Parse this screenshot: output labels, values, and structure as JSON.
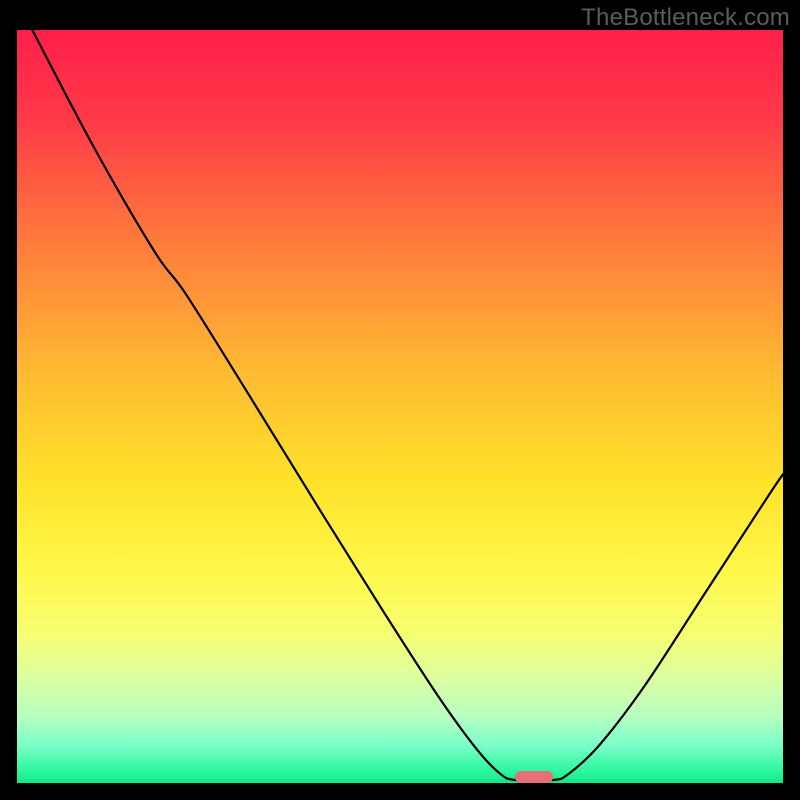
{
  "watermark": "TheBottleneck.com",
  "chart_data": {
    "type": "line",
    "title": "",
    "xlabel": "",
    "ylabel": "",
    "xlim": [
      0,
      100
    ],
    "ylim": [
      0,
      100
    ],
    "background_gradient_stops": [
      {
        "offset": 0.0,
        "color": "#ff1f4a"
      },
      {
        "offset": 0.12,
        "color": "#ff3a48"
      },
      {
        "offset": 0.28,
        "color": "#ff7a3c"
      },
      {
        "offset": 0.45,
        "color": "#ffb932"
      },
      {
        "offset": 0.6,
        "color": "#ffe22a"
      },
      {
        "offset": 0.72,
        "color": "#fff84a"
      },
      {
        "offset": 0.8,
        "color": "#f6ff70"
      },
      {
        "offset": 0.86,
        "color": "#dcffa0"
      },
      {
        "offset": 0.91,
        "color": "#b8ffc0"
      },
      {
        "offset": 0.95,
        "color": "#7affc8"
      },
      {
        "offset": 0.985,
        "color": "#29f79e"
      },
      {
        "offset": 1.0,
        "color": "#18e888"
      }
    ],
    "series": [
      {
        "name": "bottleneck-curve",
        "color": "#000000",
        "width": 2.2,
        "points": [
          {
            "x": 2.0,
            "y": 100.0
          },
          {
            "x": 10.0,
            "y": 84.5
          },
          {
            "x": 18.0,
            "y": 70.5
          },
          {
            "x": 22.0,
            "y": 65.0
          },
          {
            "x": 30.0,
            "y": 52.0
          },
          {
            "x": 40.0,
            "y": 35.5
          },
          {
            "x": 48.0,
            "y": 22.5
          },
          {
            "x": 55.0,
            "y": 11.5
          },
          {
            "x": 60.0,
            "y": 4.5
          },
          {
            "x": 63.0,
            "y": 1.3
          },
          {
            "x": 65.0,
            "y": 0.4
          },
          {
            "x": 70.0,
            "y": 0.4
          },
          {
            "x": 72.0,
            "y": 1.2
          },
          {
            "x": 76.0,
            "y": 5.0
          },
          {
            "x": 82.0,
            "y": 13.0
          },
          {
            "x": 90.0,
            "y": 25.5
          },
          {
            "x": 98.0,
            "y": 38.0
          },
          {
            "x": 100.0,
            "y": 41.0
          }
        ]
      }
    ],
    "optimal_marker": {
      "x": 67.5,
      "y": 0.0,
      "width": 5.0,
      "height": 1.6,
      "color": "#e96f76"
    }
  }
}
